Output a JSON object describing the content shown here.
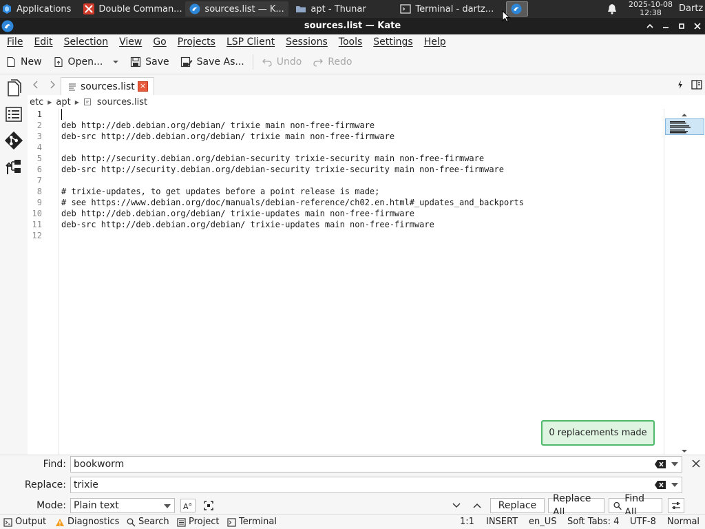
{
  "taskbar": {
    "apps_label": "Applications",
    "windows": [
      {
        "label": "Double Comman..."
      },
      {
        "label": "sources.list — K..."
      },
      {
        "label": "apt - Thunar"
      },
      {
        "label": "Terminal - dartz..."
      }
    ],
    "clock_date": "2025-10-08",
    "clock_time": "12:38",
    "user": "Dartz"
  },
  "window": {
    "title": "sources.list — Kate"
  },
  "menu": {
    "items": [
      "File",
      "Edit",
      "Selection",
      "View",
      "Go",
      "Projects",
      "LSP Client",
      "Sessions",
      "Tools",
      "Settings",
      "Help"
    ]
  },
  "toolbar": {
    "new_label": "New",
    "open_label": "Open...",
    "save_label": "Save",
    "save_as_label": "Save As...",
    "undo_label": "Undo",
    "redo_label": "Redo"
  },
  "tab": {
    "label": "sources.list",
    "close_glyph": "×"
  },
  "breadcrumb": {
    "parts": [
      "etc",
      "apt",
      "sources.list"
    ]
  },
  "editor": {
    "lines": [
      {
        "num": "1",
        "text": ""
      },
      {
        "num": "2",
        "text": "deb http://deb.debian.org/debian/ trixie main non-free-firmware"
      },
      {
        "num": "3",
        "text": "deb-src http://deb.debian.org/debian/ trixie main non-free-firmware"
      },
      {
        "num": "4",
        "text": ""
      },
      {
        "num": "5",
        "text": "deb http://security.debian.org/debian-security trixie-security main non-free-firmware"
      },
      {
        "num": "6",
        "text": "deb-src http://security.debian.org/debian-security trixie-security main non-free-firmware"
      },
      {
        "num": "7",
        "text": ""
      },
      {
        "num": "8",
        "text": "# trixie-updates, to get updates before a point release is made;"
      },
      {
        "num": "9",
        "text": "# see https://www.debian.org/doc/manuals/debian-reference/ch02.en.html#_updates_and_backports"
      },
      {
        "num": "10",
        "text": "deb http://deb.debian.org/debian/ trixie-updates main non-free-firmware"
      },
      {
        "num": "11",
        "text": "deb-src http://deb.debian.org/debian/ trixie-updates main non-free-firmware"
      },
      {
        "num": "12",
        "text": ""
      }
    ]
  },
  "notification": {
    "text": "0 replacements made"
  },
  "find_panel": {
    "find_label": "Find:",
    "find_value": "bookworm",
    "replace_label": "Replace:",
    "replace_value": "trixie",
    "mode_label": "Mode:",
    "mode_value": "Plain text",
    "replace_button": "Replace",
    "replace_all_button": "Replace All",
    "find_all_button": "Find All"
  },
  "statusbar": {
    "output": "Output",
    "diagnostics": "Diagnostics",
    "search": "Search",
    "project": "Project",
    "terminal": "Terminal",
    "position": "1:1",
    "input_mode": "INSERT",
    "language": "en_US",
    "indentation": "Soft Tabs: 4",
    "encoding": "UTF-8",
    "view_mode": "Normal"
  },
  "colors": {
    "notice_bg": "#dff5e2",
    "notice_border": "#4fb86a",
    "tab_close": "#e85a3c",
    "titlebar": "#1f1f1f",
    "taskbar": "#2b2b2b"
  }
}
